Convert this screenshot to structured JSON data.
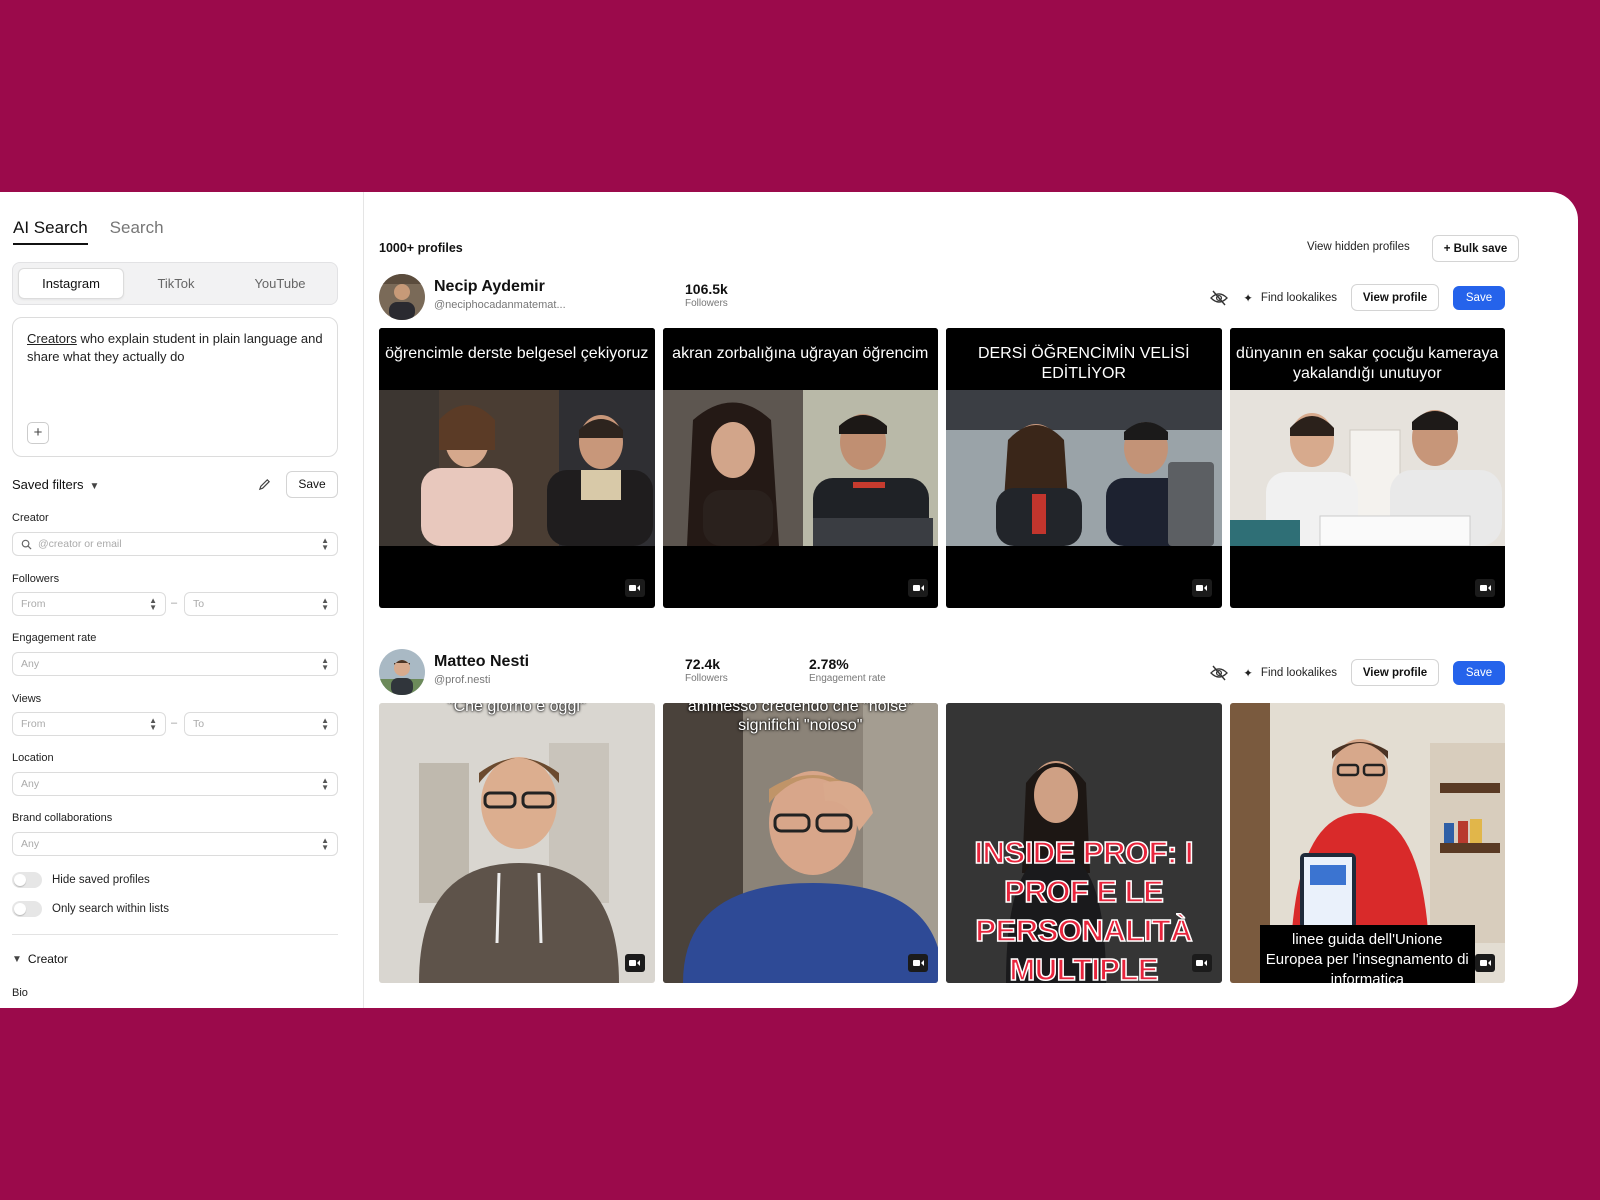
{
  "sidebar": {
    "modes": [
      "AI Search",
      "Search"
    ],
    "platforms": [
      "Instagram",
      "TikTok",
      "YouTube"
    ],
    "prompt": {
      "underlined_word": "Creators",
      "rest": " who explain student in plain language and share what they actually do",
      "add": "+"
    },
    "saved_filters": {
      "label": "Saved filters",
      "save": "Save"
    },
    "creator": {
      "label": "Creator",
      "placeholder": "@creator or email"
    },
    "followers": {
      "label": "Followers",
      "from": "From",
      "to": "To"
    },
    "engagement": {
      "label": "Engagement rate",
      "value": "Any"
    },
    "views": {
      "label": "Views",
      "from": "From",
      "to": "To"
    },
    "location": {
      "label": "Location",
      "value": "Any"
    },
    "brand": {
      "label": "Brand collaborations",
      "value": "Any"
    },
    "toggles": [
      "Hide saved profiles",
      "Only search within lists"
    ],
    "section": "Creator",
    "bio_label": "Bio",
    "dash": "–"
  },
  "results": {
    "count": "1000+ profiles",
    "view_hidden": "View hidden profiles",
    "bulk_save": "+ Bulk save"
  },
  "actions": {
    "find_lookalikes": "Find lookalikes",
    "view_profile": "View profile",
    "save": "Save"
  },
  "profiles": [
    {
      "name": "Necip Aydemir",
      "handle": "@neciphocadanmatemat...",
      "followers": "106.5k",
      "followers_label": "Followers",
      "thumbs": [
        "öğrencimle derste belgesel çekiyoruz",
        "akran zorbalığına uğrayan öğrencim",
        "DERSİ ÖĞRENCİMİN VELİSİ EDİTLİYOR",
        "dünyanın en sakar çocuğu kameraya yakalandığı unutuyor"
      ]
    },
    {
      "name": "Matteo Nesti",
      "handle": "@prof.nesti",
      "followers": "72.4k",
      "followers_label": "Followers",
      "engagement": "2.78%",
      "engagement_label": "Engagement rate",
      "thumbs": [
        "\"Che giorno è oggi\"",
        "ammesso credendo che \"noise\" significhi \"noioso\"",
        "INSIDE PROF: I PROF E LE PERSONALITÀ MULTIPLE",
        "linee guida dell'Unione Europea per l'insegnamento di informatica"
      ]
    }
  ],
  "colors": {
    "background": "#9b0a4b",
    "primary": "#2563eb"
  },
  "icons": [
    "search-icon",
    "chevron-down-icon",
    "pencil-icon",
    "eye-off-icon",
    "sparkle-icon",
    "video-camera-icon",
    "select-caret-icon"
  ]
}
